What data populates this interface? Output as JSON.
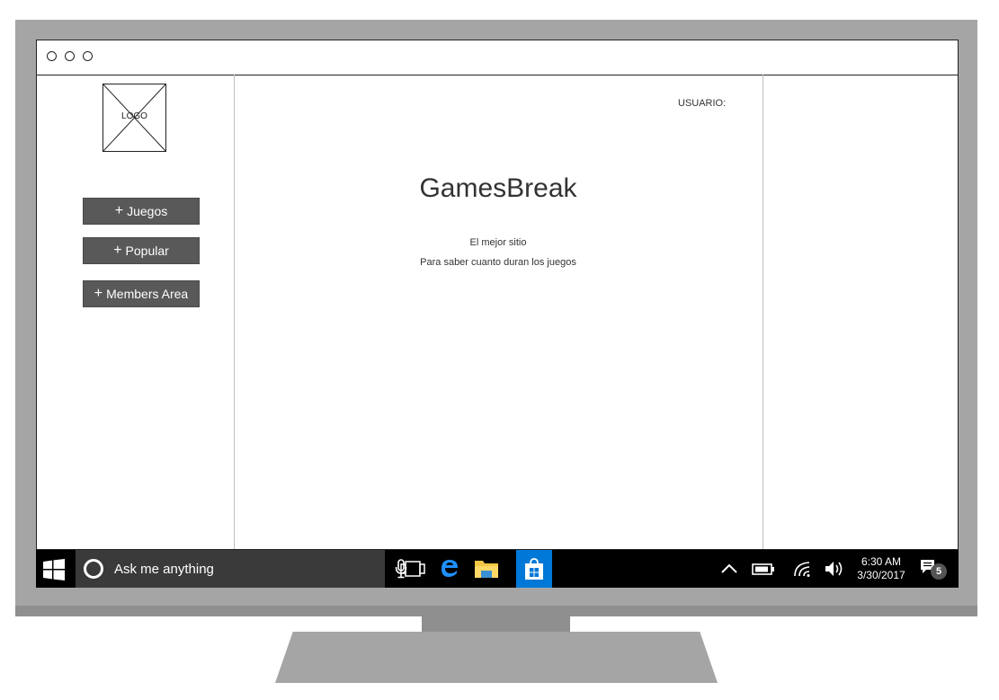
{
  "sidebar": {
    "logo_label": "LOGO",
    "nav": [
      {
        "label": "Juegos"
      },
      {
        "label": "Popular"
      },
      {
        "label": "Members Area"
      }
    ]
  },
  "header": {
    "user_label": "USUARIO:"
  },
  "main": {
    "title": "GamesBreak",
    "tagline_1": "El mejor sitio",
    "tagline_2": "Para saber cuanto duran los juegos"
  },
  "taskbar": {
    "search_placeholder": "Ask me anything",
    "time": "6:30 AM",
    "date": "3/30/2017",
    "notification_count": "5",
    "store_color": "#0078d7",
    "edge_color": "#1e90ff",
    "explorer_color": "#f2c744"
  }
}
